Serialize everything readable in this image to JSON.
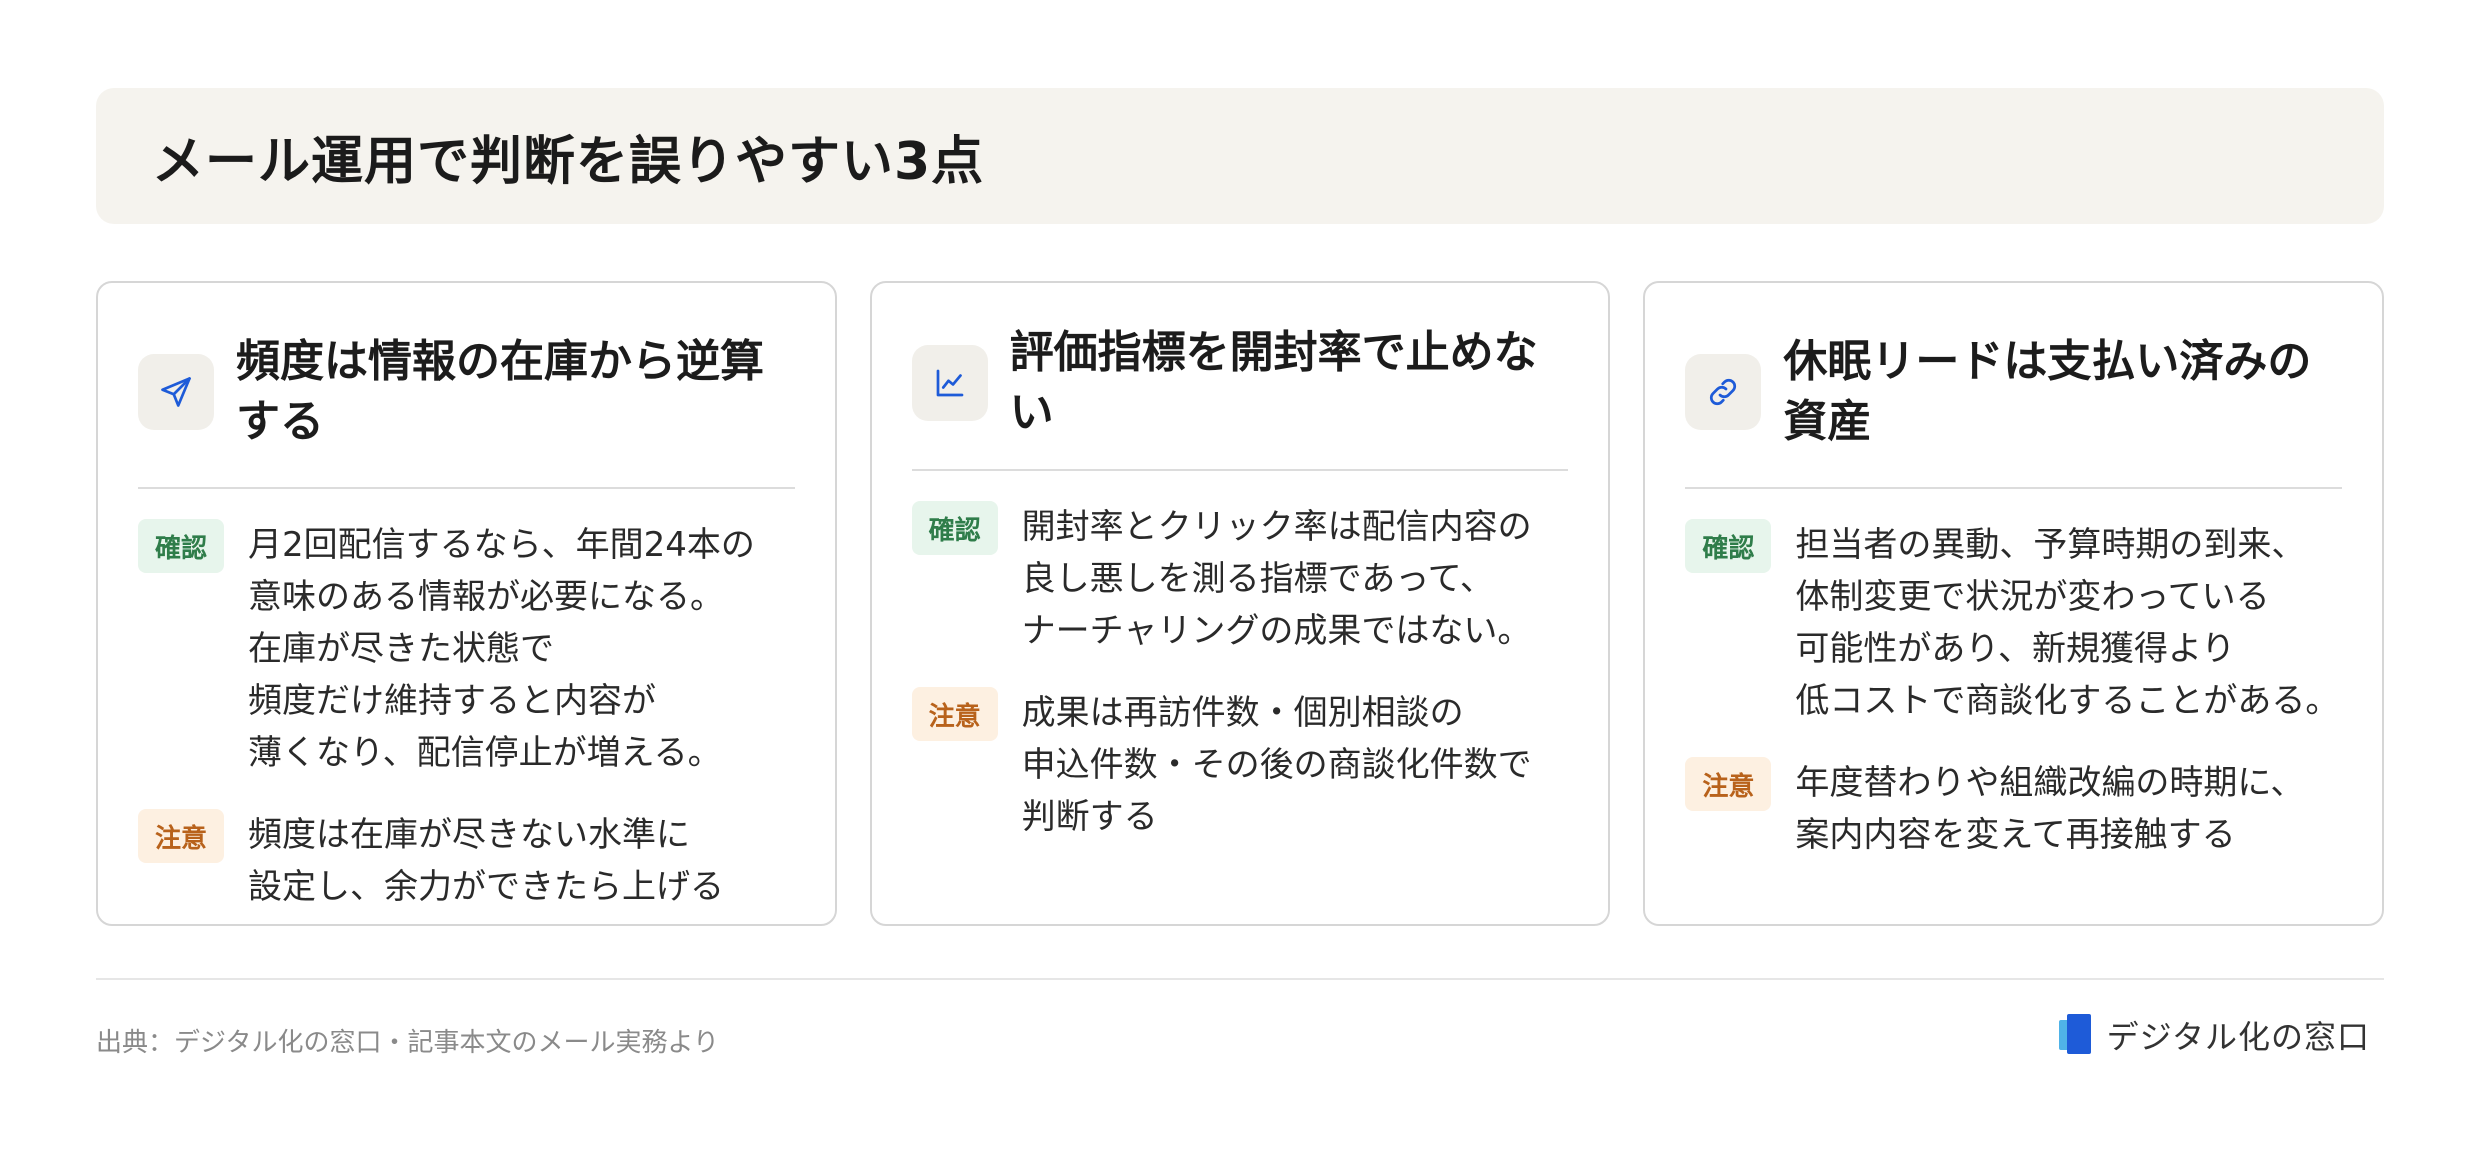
{
  "header": {
    "title": "メール運用で判断を誤りやすい3点"
  },
  "cards": [
    {
      "icon": "send-icon",
      "title": "頻度は情報の在庫から逆算する",
      "confirm_label": "確認",
      "confirm_text": "月2回配信するなら、年間24本の\n意味のある情報が必要になる。\n在庫が尽きた状態で\n頻度だけ維持すると内容が\n薄くなり、配信停止が増える。",
      "caution_label": "注意",
      "caution_text": "頻度は在庫が尽きない水準に\n設定し、余力ができたら上げる"
    },
    {
      "icon": "line-chart-icon",
      "title": "評価指標を開封率で止めない",
      "confirm_label": "確認",
      "confirm_text": "開封率とクリック率は配信内容の\n良し悪しを測る指標であって、\nナーチャリングの成果ではない。",
      "caution_label": "注意",
      "caution_text": "成果は再訪件数・個別相談の\n申込件数・その後の商談化件数で\n判断する"
    },
    {
      "icon": "link-icon",
      "title": "休眠リードは支払い済みの資産",
      "confirm_label": "確認",
      "confirm_text": "担当者の異動、予算時期の到来、\n体制変更で状況が変わっている\n可能性があり、新規獲得より\n低コストで商談化することがある。",
      "caution_label": "注意",
      "caution_text": "年度替わりや組織改編の時期に、\n案内内容を変えて再接触する"
    }
  ],
  "footer": {
    "source": "出典：デジタル化の窓口・記事本文のメール実務より",
    "brand": "デジタル化の窓口"
  },
  "colors": {
    "accent": "#1e5bd8",
    "confirm_bg": "#e7f5ec",
    "confirm_text": "#2f7d4a",
    "caution_bg": "#fdf0e1",
    "caution_text": "#b8621b"
  }
}
